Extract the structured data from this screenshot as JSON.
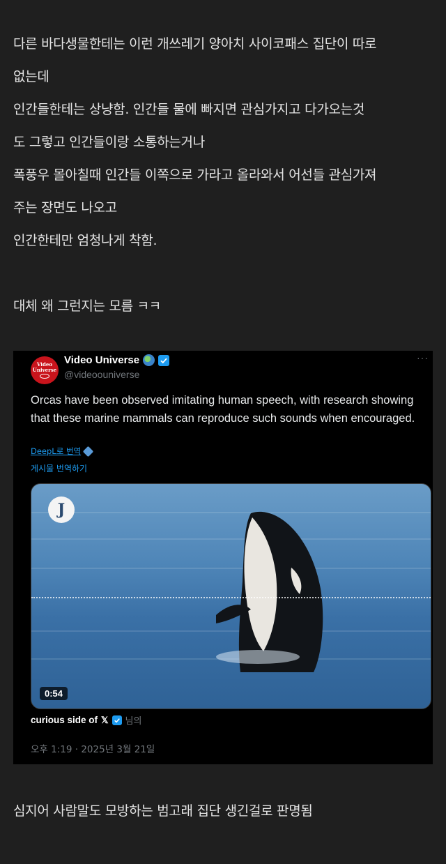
{
  "post": {
    "lines": [
      "다른 바다생물한테는 이런 개쓰레기 양아치 사이코패스 집단이 따로",
      "없는데",
      "인간들한테는 상냥함.  인간들 물에 빠지면 관심가지고 다가오는것",
      "도 그렇고 인간들이랑 소통하는거나",
      "폭풍우 몰아칠때 인간들 이쪽으로 가라고 올라와서 어선들 관심가져",
      "주는 장면도 나오고",
      "인간한테만 엄청나게 착함."
    ],
    "line_after_gap": "대체 왜 그런지는 모름 ㅋㅋ",
    "bottom_line": "심지어 사람말도 모방하는 범고래 집단 생긴걸로 판명됨"
  },
  "tweet": {
    "avatar_text": "Video Universe",
    "display_name": "Video Universe",
    "handle": "@videoouniverse",
    "more": "···",
    "body": "Orcas have been observed imitating human speech, with research showing that these marine mammals can reproduce such sounds when encouraged.",
    "deepl_link": "DeepL로 번역",
    "translate_link": "게시물 번역하기",
    "video": {
      "channel_letter": "J",
      "duration": "0:54"
    },
    "source_name": "curious side of",
    "source_x": "𝕏",
    "source_suffix": "님의",
    "timestamp": "오후 1:19 · 2025년 3월 21일"
  },
  "colors": {
    "page_bg": "#1f1f1f",
    "embed_bg": "#000000",
    "link": "#1d9bf0",
    "verified": "#1d9bf0",
    "avatar_red": "#c9141c"
  },
  "icons": [
    "globe-icon",
    "verified-icon",
    "more-icon",
    "deepl-icon",
    "x-icon"
  ]
}
